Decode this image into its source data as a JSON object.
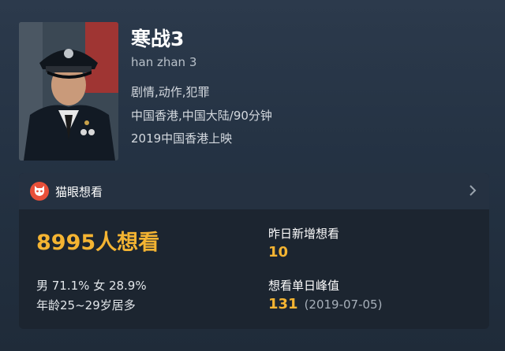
{
  "movie": {
    "title": "寒战3",
    "pinyin": "han zhan 3",
    "genres": "剧情,动作,犯罪",
    "region_duration": "中国香港,中国大陆/90分钟",
    "release": "2019中国香港上映"
  },
  "card": {
    "header_label": "猫眼想看",
    "total_wants": "8995人想看",
    "gender_ratio": "男 71.1%  女 28.9%",
    "age_info": "年龄25~29岁居多",
    "yesterday_label": "昨日新增想看",
    "yesterday_value": "10",
    "peak_label": "想看单日峰值",
    "peak_value": "131",
    "peak_date": "(2019-07-05)"
  },
  "icons": {
    "logo": "maoyan-cat-logo-icon",
    "chevron": "chevron-right-icon"
  },
  "colors": {
    "accent": "#f4b432",
    "logo_red": "#e8503a"
  }
}
